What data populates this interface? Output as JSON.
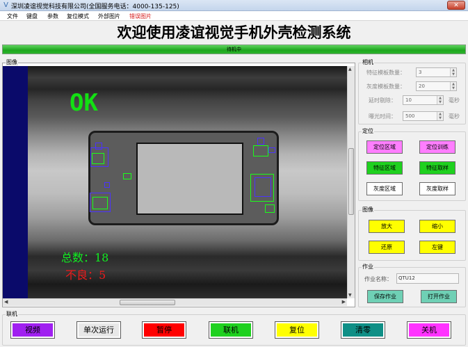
{
  "window": {
    "title": "深圳凌谊视觉科技有限公司(全国服务电话：4000-135-125)",
    "close_label": "✕"
  },
  "menu": [
    "文件",
    "键盘",
    "参数",
    "复位模式",
    "外部图片",
    "错误图片"
  ],
  "heading": "欢迎使用凌谊视觉手机外壳检测系统",
  "status": "待机中",
  "image_group": {
    "label": "图像",
    "result": "OK",
    "total": "总数：18",
    "bad": "不良：5"
  },
  "camera": {
    "label": "相机",
    "feature_template_label": "特征模板数量：",
    "feature_template_value": "3",
    "gray_template_label": "灰度模板数量：",
    "gray_template_value": "20",
    "delay_label": "延时剔除：",
    "delay_value": "10",
    "delay_unit": "毫秒",
    "exposure_label": "曝光时间：",
    "exposure_value": "500",
    "exposure_unit": "毫秒"
  },
  "locate": {
    "label": "定位",
    "buttons": [
      "定位区域",
      "定位训练",
      "特征区域",
      "特征取样",
      "灰度区域",
      "灰度取样"
    ]
  },
  "image_ops": {
    "label": "图像",
    "buttons": [
      "放大",
      "缩小",
      "还原",
      "左键"
    ]
  },
  "job": {
    "label": "作业",
    "name_label": "作业名称：",
    "name_value": "QTU12",
    "save": "保存作业",
    "open": "打开作业"
  },
  "online": {
    "label": "联机",
    "buttons": [
      {
        "label": "视频",
        "color": "#a020f0"
      },
      {
        "label": "单次运行",
        "color": "#e8e8e8"
      },
      {
        "label": "暂停",
        "color": "#ff0000"
      },
      {
        "label": "联机",
        "color": "#1fd11f"
      },
      {
        "label": "复位",
        "color": "#ffff00"
      },
      {
        "label": "清零",
        "color": "#0f8f86"
      },
      {
        "label": "关机",
        "color": "#ff33ff"
      }
    ]
  }
}
